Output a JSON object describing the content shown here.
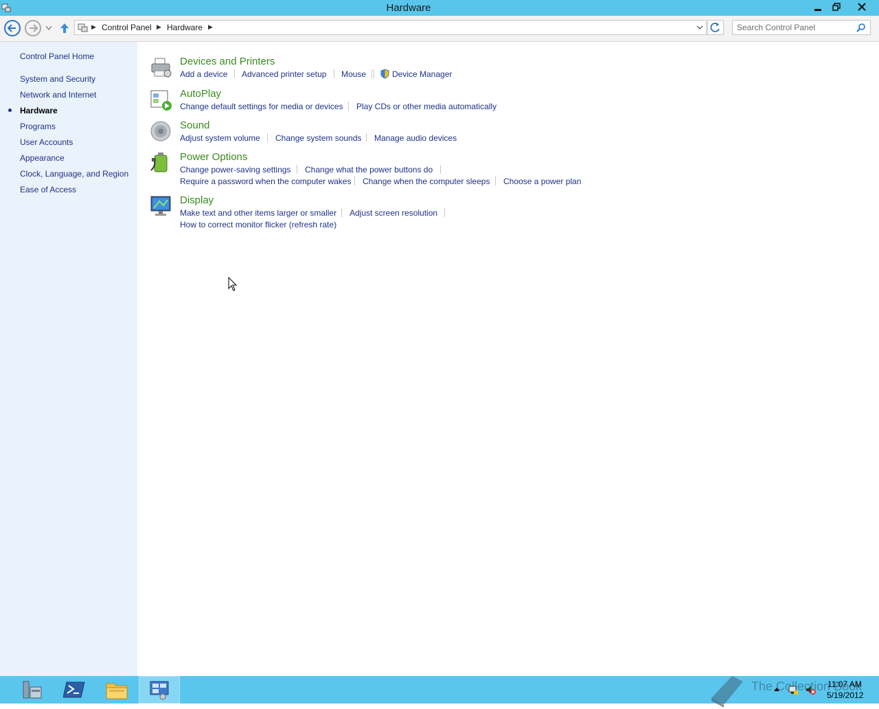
{
  "window": {
    "title": "Hardware"
  },
  "address_bar": {
    "crumbs": [
      "Control Panel",
      "Hardware"
    ]
  },
  "search": {
    "placeholder": "Search Control Panel"
  },
  "sidebar": {
    "items": [
      {
        "label": "Control Panel Home"
      },
      {
        "label": "System and Security"
      },
      {
        "label": "Network and Internet"
      },
      {
        "label": "Hardware",
        "current": true
      },
      {
        "label": "Programs"
      },
      {
        "label": "User Accounts"
      },
      {
        "label": "Appearance"
      },
      {
        "label": "Clock, Language, and Region"
      },
      {
        "label": "Ease of Access"
      }
    ]
  },
  "categories": [
    {
      "title": "Devices and Printers",
      "icon": "printer-icon",
      "links": [
        "Add a device",
        "Advanced printer setup",
        "Mouse",
        "Device Manager"
      ]
    },
    {
      "title": "AutoPlay",
      "icon": "autoplay-icon",
      "links": [
        "Change default settings for media or devices",
        "Play CDs or other media automatically"
      ]
    },
    {
      "title": "Sound",
      "icon": "speaker-icon",
      "links": [
        "Adjust system volume",
        "Change system sounds",
        "Manage audio devices"
      ]
    },
    {
      "title": "Power Options",
      "icon": "battery-icon",
      "links": [
        "Change power-saving settings",
        "Change what the power buttons do",
        "Require a password when the computer wakes",
        "Change when the computer sleeps",
        "Choose a power plan"
      ]
    },
    {
      "title": "Display",
      "icon": "monitor-icon",
      "links": [
        "Make text and other items larger or smaller",
        "Adjust screen resolution",
        "How to correct monitor flicker (refresh rate)"
      ]
    }
  ],
  "taskbar": {
    "buttons": [
      "server-manager-icon",
      "powershell-icon",
      "file-explorer-icon",
      "control-panel-icon"
    ],
    "watermark": "The Collection Book",
    "time": "11:07 AM",
    "date": "5/19/2012"
  },
  "colors": {
    "titlebar": "#58c5ea",
    "link": "#1e3287",
    "category_title": "#3a8a1f",
    "sidebar": "#eaf2fb",
    "taskbar": "#5ac6ee"
  }
}
